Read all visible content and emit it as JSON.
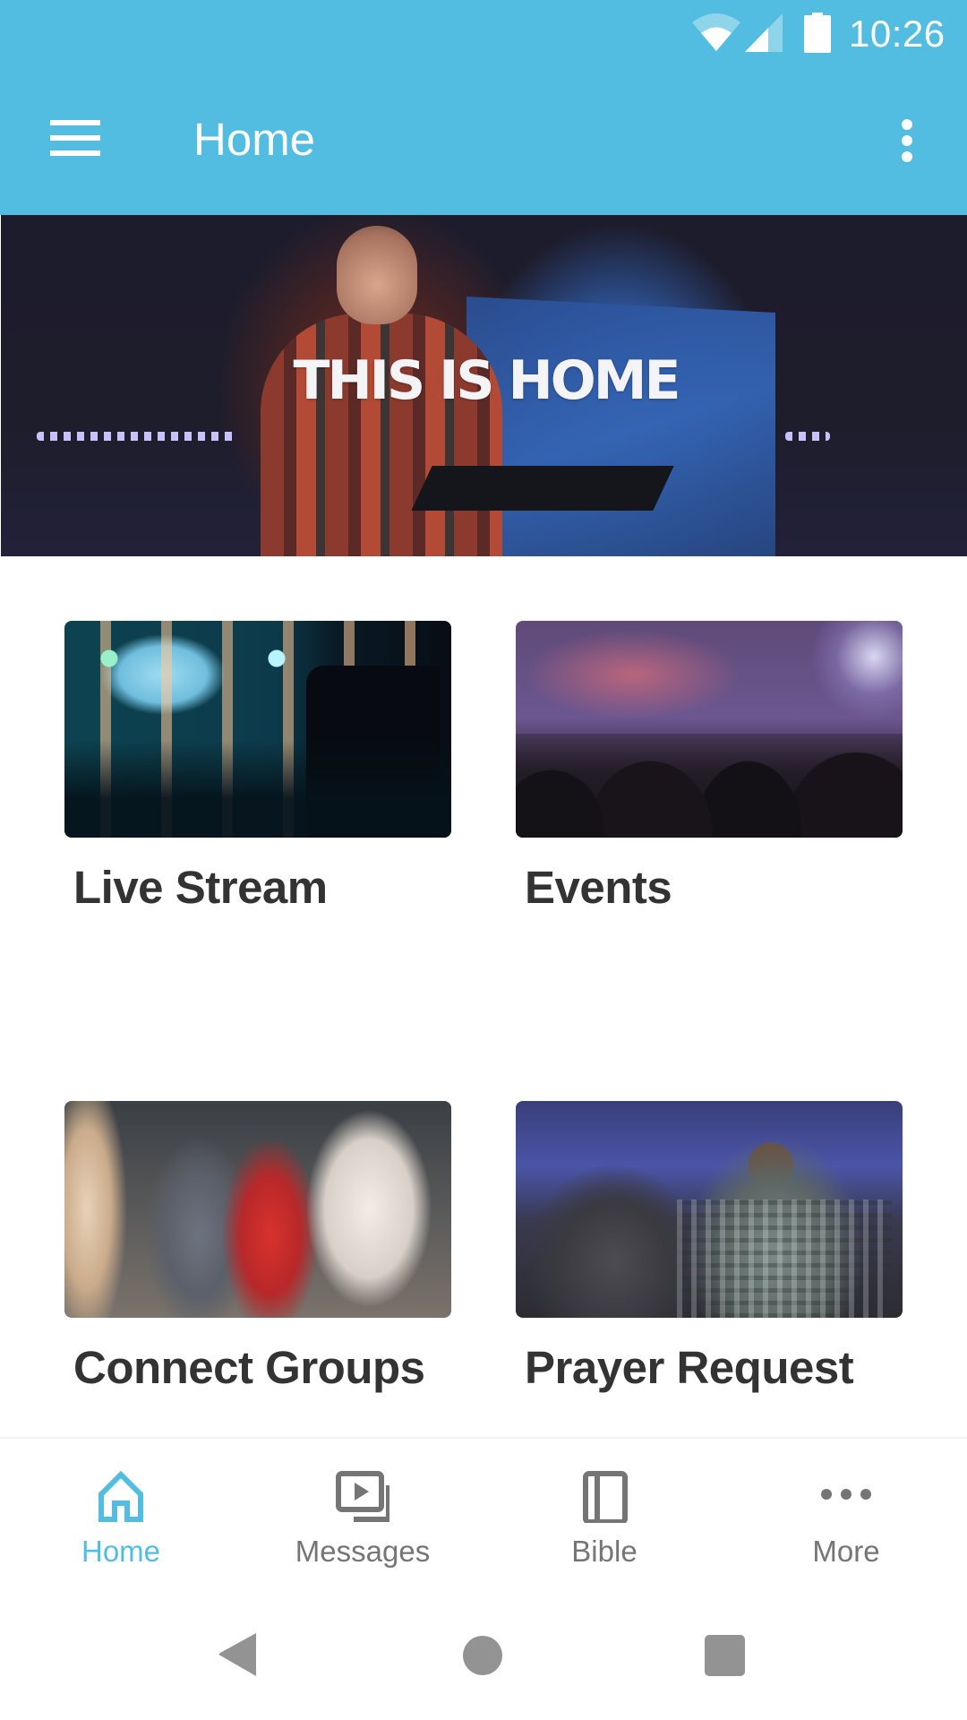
{
  "status_bar": {
    "time": "10:26",
    "icons": [
      "wifi-icon",
      "cellular-signal-icon",
      "battery-icon"
    ]
  },
  "app_bar": {
    "title": "Home",
    "menu_icon": "hamburger-menu-icon",
    "overflow_icon": "more-vertical-icon"
  },
  "hero": {
    "title": "THIS IS HOME",
    "image": "pastor-on-stage-photo"
  },
  "tiles": [
    {
      "label": "Live Stream",
      "image": "stage-camera-photo"
    },
    {
      "label": "Events",
      "image": "worship-concert-photo"
    },
    {
      "label": "Connect Groups",
      "image": "women-dining-photo"
    },
    {
      "label": "Prayer Request",
      "image": "people-praying-photo"
    }
  ],
  "bottom_nav": {
    "active_index": 0,
    "accent_color": "#52bde1",
    "inactive_color": "#757575",
    "items": [
      {
        "label": "Home",
        "icon": "home-icon"
      },
      {
        "label": "Messages",
        "icon": "video-library-icon"
      },
      {
        "label": "Bible",
        "icon": "book-icon"
      },
      {
        "label": "More",
        "icon": "more-horizontal-icon"
      }
    ]
  },
  "system_nav": {
    "buttons": [
      "back-icon",
      "home-circle-icon",
      "recents-icon"
    ]
  },
  "theme": {
    "primary": "#52bde1",
    "text_dark": "#333333"
  }
}
